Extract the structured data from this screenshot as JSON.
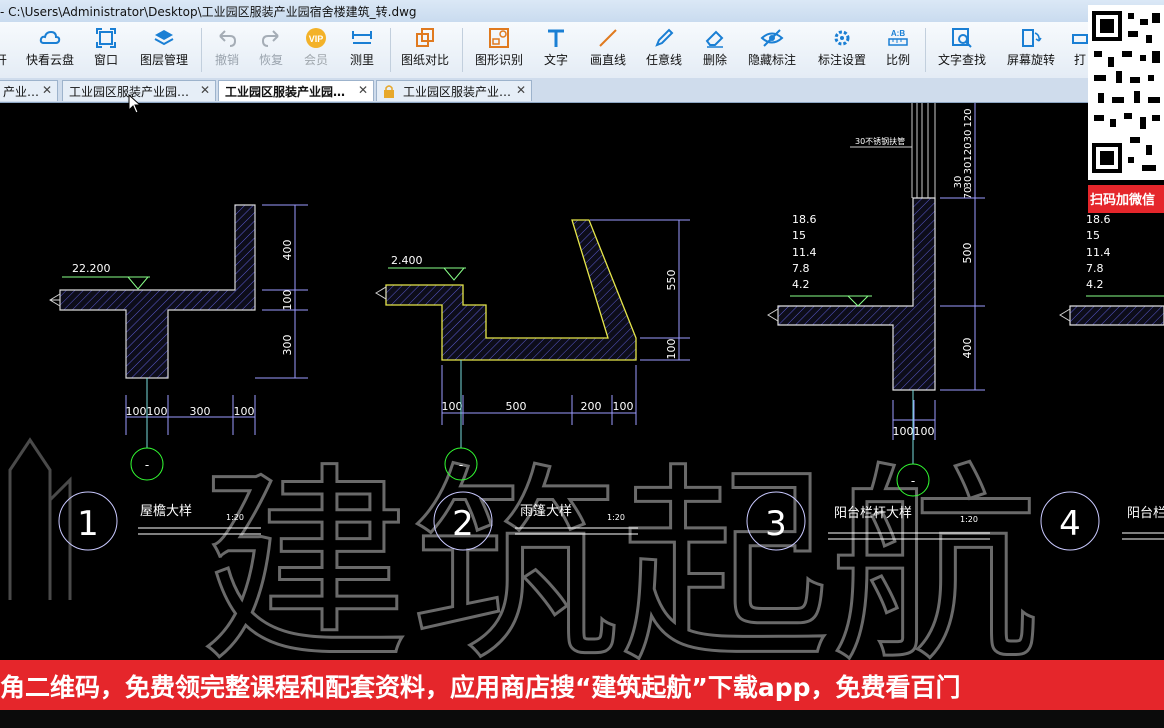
{
  "window": {
    "title": "- C:\\Users\\Administrator\\Desktop\\工业园区服装产业园宿舍楼建筑_转.dwg"
  },
  "toolbar": {
    "items": [
      {
        "label": "开",
        "icon": "open-icon"
      },
      {
        "label": "快看云盘",
        "icon": "cloud-icon"
      },
      {
        "label": "窗口",
        "icon": "window-icon"
      },
      {
        "label": "图层管理",
        "icon": "layers-icon"
      },
      {
        "label": "撤销",
        "icon": "undo-icon"
      },
      {
        "label": "恢复",
        "icon": "redo-icon"
      },
      {
        "label": "会员",
        "icon": "vip-icon"
      },
      {
        "label": "测里",
        "icon": "measure-icon"
      },
      {
        "label": "图纸对比",
        "icon": "compare-icon"
      },
      {
        "label": "图形识别",
        "icon": "recognize-icon"
      },
      {
        "label": "文字",
        "icon": "text-icon"
      },
      {
        "label": "画直线",
        "icon": "line-icon"
      },
      {
        "label": "任意线",
        "icon": "freeline-icon"
      },
      {
        "label": "删除",
        "icon": "eraser-icon"
      },
      {
        "label": "隐藏标注",
        "icon": "hide-icon"
      },
      {
        "label": "标注设置",
        "icon": "settings-icon"
      },
      {
        "label": "比例",
        "icon": "scale-icon"
      },
      {
        "label": "文字查找",
        "icon": "find-text-icon"
      },
      {
        "label": "屏幕旋转",
        "icon": "rotate-icon"
      },
      {
        "label": "打",
        "icon": "print-icon"
      }
    ]
  },
  "tabs": [
    {
      "label": "产业…"
    },
    {
      "label": "工业园区服装产业园…"
    },
    {
      "label": "工业园区服装产业园…"
    },
    {
      "label": "工业园区服装产业…"
    }
  ],
  "drawing": {
    "detail1": {
      "elev": "22.200",
      "dims_v": [
        "400",
        "100",
        "300"
      ],
      "dims_h": [
        "100",
        "100",
        "300",
        "100"
      ],
      "num": "1",
      "title": "屋檐大样",
      "scale": "1:20",
      "axis": "-"
    },
    "detail2": {
      "elev": "2.400",
      "dims_v": [
        "550",
        "100"
      ],
      "dims_h": [
        "100",
        "500",
        "200",
        "100"
      ],
      "num": "2",
      "title": "雨篷大样",
      "scale": "1:20",
      "axis": "-"
    },
    "detail3": {
      "elevs": [
        "18.6",
        "15",
        "11.4",
        "7.8",
        "4.2"
      ],
      "note": "30不锈钢扶管",
      "dims_v": [
        "120",
        "30",
        "120",
        "30",
        "120",
        "30",
        "70",
        "30",
        "500",
        "400"
      ],
      "dims_h": [
        "100",
        "100"
      ],
      "num": "3",
      "title": "阳台栏杆大样",
      "scale": "1:20",
      "axis": "-"
    },
    "detail4": {
      "elevs": [
        "18.6",
        "15",
        "11.4",
        "7.8",
        "4.2"
      ],
      "num": "4",
      "title": "阳台栏"
    },
    "watermark": "建筑起航"
  },
  "overlay": {
    "qr_label": "扫码加微信",
    "banner": "角二维码，免费领完整课程和配套资料，应用商店搜“建筑起航”下载app，免费看百门"
  }
}
